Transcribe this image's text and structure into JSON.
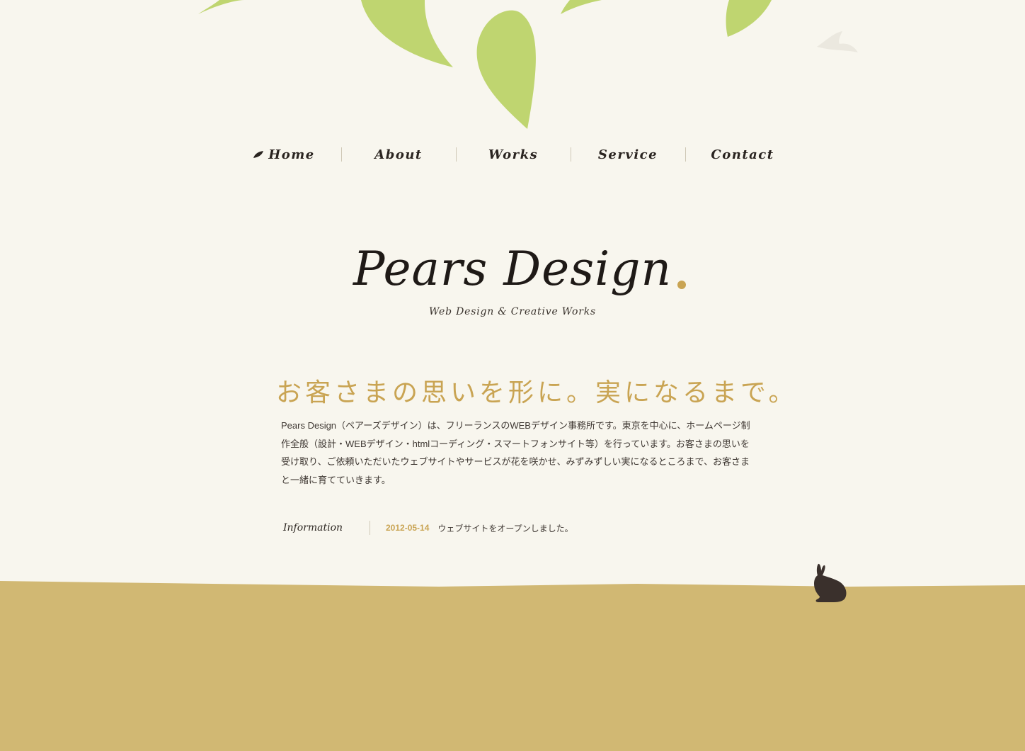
{
  "nav": {
    "items": [
      {
        "label": "Home"
      },
      {
        "label": "About"
      },
      {
        "label": "Works"
      },
      {
        "label": "Service"
      },
      {
        "label": "Contact"
      }
    ]
  },
  "brand": {
    "logo": "Pears Design",
    "tagline": "Web Design & Creative Works"
  },
  "hero": {
    "headline": "お客さまの思いを形に。実になるまで。",
    "paragraph": "Pears Design（ペアーズデザイン）は、フリーランスのWEBデザイン事務所です。東京を中心に、ホームページ制作全般（設計・WEBデザイン・htmlコーディング・スマートフォンサイト等）を行っています。お客さまの思いを受け取り、ご依頼いただいたウェブサイトやサービスが花を咲かせ、みずみずしい実になるところまで、お客さまと一緒に育てていきます。"
  },
  "information": {
    "label": "Information",
    "items": [
      {
        "date": "2012-05-14",
        "text": "ウェブサイトをオープンしました。"
      }
    ]
  },
  "theme": {
    "background": "#f8f6ee",
    "leaf_green": "#bfd570",
    "accent_gold": "#c9a453",
    "ground": "#d1b873",
    "rabbit": "#3a302c"
  },
  "icons": [
    "leaf-icon",
    "rabbit-icon",
    "bird-icon"
  ]
}
